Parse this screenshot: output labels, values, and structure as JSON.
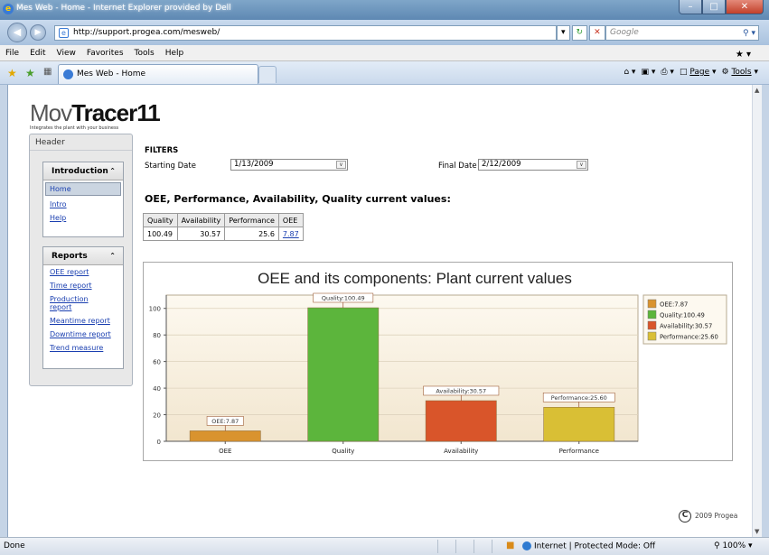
{
  "browser": {
    "window_title": "Mes Web - Home - Internet Explorer provided by Dell",
    "url": "http://support.progea.com/mesweb/",
    "search_placeholder": "Google",
    "menu": [
      "File",
      "Edit",
      "View",
      "Favorites",
      "Tools",
      "Help"
    ],
    "tab_title": "Mes Web - Home",
    "tools": {
      "page": "Page",
      "tools": "Tools"
    },
    "status": {
      "text": "Done",
      "zone": "Internet | Protected Mode: Off",
      "zoom": "100%"
    }
  },
  "page": {
    "logo": {
      "text_light": "Mov",
      "text_bold": "Tracer11",
      "tagline": "Integrates the plant with your business"
    },
    "sidebar": {
      "header": "Header",
      "intro_title": "Introduction",
      "intro_items": [
        "Home",
        "Intro",
        "Help"
      ],
      "reports_title": "Reports",
      "report_items": [
        "OEE report",
        "Time report",
        "Production report",
        "Meantime report",
        "Downtime report",
        "Trend measure"
      ]
    },
    "filters": {
      "title": "FILTERS",
      "start_label": "Starting Date",
      "start_value": "1/13/2009",
      "final_label": "Final Date",
      "final_value": "2/12/2009"
    },
    "section_title": "OEE, Performance, Availability, Quality current values:",
    "table": {
      "headers": [
        "Quality",
        "Availability",
        "Performance",
        "OEE"
      ],
      "row": [
        "100.49",
        "30.57",
        "25.6",
        "7.87"
      ]
    },
    "copyright": "2009 Progea"
  },
  "chart_data": {
    "type": "bar",
    "title": "OEE and its components: Plant current values",
    "categories": [
      "OEE",
      "Quality",
      "Availability",
      "Performance"
    ],
    "values": [
      7.87,
      100.49,
      30.57,
      25.6
    ],
    "bar_labels": [
      "OEE:7.87",
      "Quality:100.49",
      "Availability:30.57",
      "Performance:25.60"
    ],
    "colors": [
      "#d9932f",
      "#5cb53c",
      "#d9552a",
      "#d9bf35"
    ],
    "legend": [
      "OEE:7.87",
      "Quality:100.49",
      "Availability:30.57",
      "Performance:25.60"
    ],
    "legend_position": "right",
    "ylim": [
      0,
      110
    ],
    "yticks": [
      0,
      20,
      40,
      60,
      80,
      100
    ],
    "grid": true
  }
}
